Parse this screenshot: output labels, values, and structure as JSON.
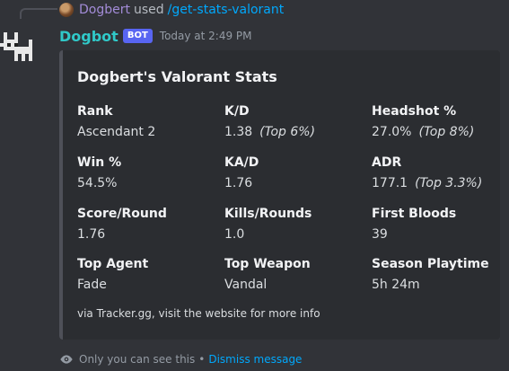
{
  "reply": {
    "user": "Dogbert",
    "used": "used",
    "command": "/get-stats-valorant"
  },
  "message": {
    "author": "Dogbot",
    "badge": "BOT",
    "timestamp": "Today at 2:49 PM"
  },
  "embed": {
    "title": "Dogbert's Valorant Stats",
    "fields": [
      {
        "name": "Rank",
        "value": "Ascendant 2",
        "extra": ""
      },
      {
        "name": "K/D",
        "value": "1.38",
        "extra": "(Top 6%)"
      },
      {
        "name": "Headshot %",
        "value": "27.0%",
        "extra": "(Top 8%)"
      },
      {
        "name": "Win %",
        "value": "54.5%",
        "extra": ""
      },
      {
        "name": "KA/D",
        "value": "1.76",
        "extra": ""
      },
      {
        "name": "ADR",
        "value": "177.1",
        "extra": "(Top 3.3%)"
      },
      {
        "name": "Score/Round",
        "value": "1.76",
        "extra": ""
      },
      {
        "name": "Kills/Rounds",
        "value": "1.0",
        "extra": ""
      },
      {
        "name": "First Bloods",
        "value": "39",
        "extra": ""
      },
      {
        "name": "Top Agent",
        "value": "Fade",
        "extra": ""
      },
      {
        "name": "Top Weapon",
        "value": "Vandal",
        "extra": ""
      },
      {
        "name": "Season Playtime",
        "value": "5h 24m",
        "extra": ""
      }
    ],
    "footer": "via Tracker.gg, visit the website for more info"
  },
  "ephemeral": {
    "notice": "Only you can see this",
    "separator": "•",
    "dismiss": "Dismiss message"
  },
  "colors": {
    "background": "#313338",
    "embed_background": "#2b2d31",
    "author": "#30c9c9",
    "reply_user": "#a38cd8",
    "link": "#00a8fc",
    "badge": "#5865f2"
  }
}
